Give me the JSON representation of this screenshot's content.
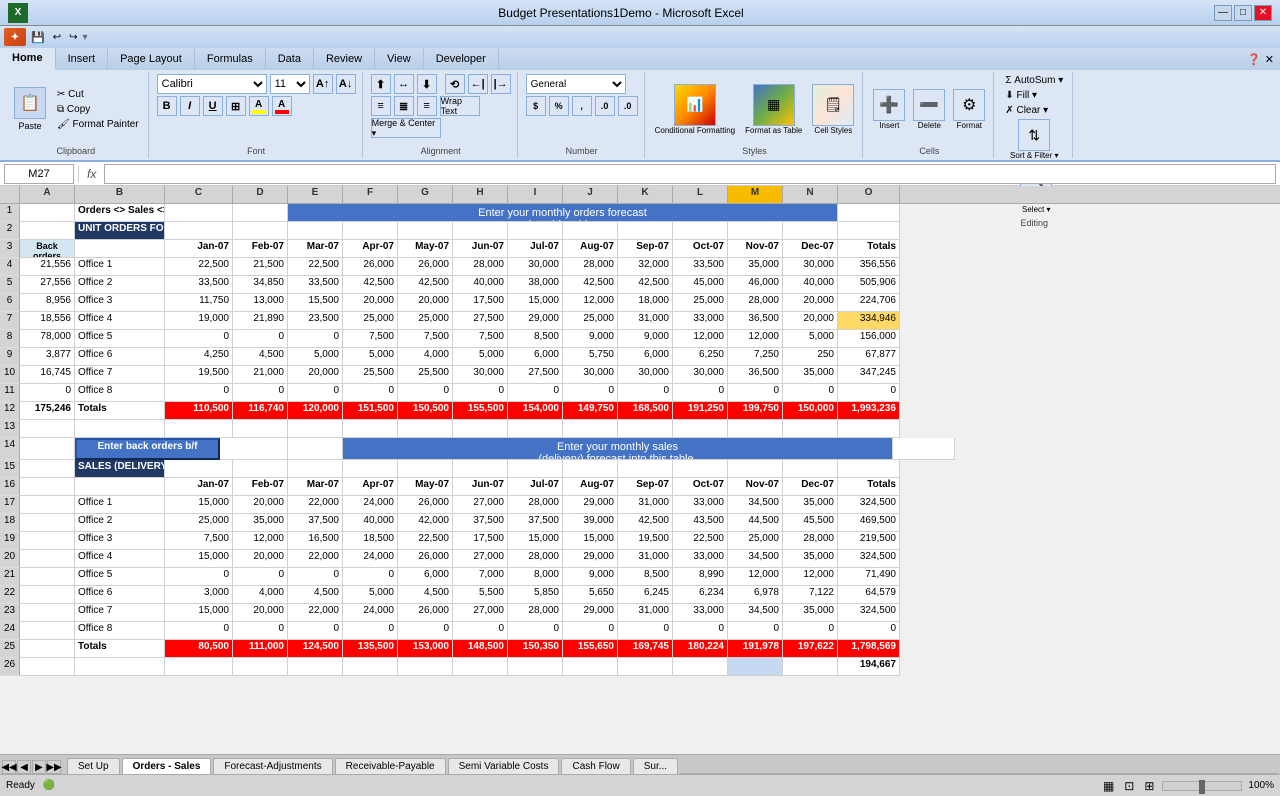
{
  "titleBar": {
    "title": "Budget Presentations1Demo - Microsoft Excel",
    "minimize": "—",
    "maximize": "□",
    "close": "✕"
  },
  "ribbonTabs": [
    {
      "label": "Home",
      "active": true
    },
    {
      "label": "Insert",
      "active": false
    },
    {
      "label": "Page Layout",
      "active": false
    },
    {
      "label": "Formulas",
      "active": false
    },
    {
      "label": "Data",
      "active": false
    },
    {
      "label": "Review",
      "active": false
    },
    {
      "label": "View",
      "active": false
    },
    {
      "label": "Developer",
      "active": false
    }
  ],
  "ribbon": {
    "clipboard": {
      "paste": "Paste",
      "cut": "Cut",
      "copy": "Copy",
      "formatPainter": "Format Painter",
      "label": "Clipboard"
    },
    "font": {
      "name": "Calibri",
      "size": "11",
      "bold": "B",
      "italic": "I",
      "underline": "U",
      "label": "Font"
    },
    "alignment": {
      "label": "Alignment",
      "wrapText": "Wrap Text",
      "mergeCenter": "Merge & Center"
    },
    "number": {
      "format": "General",
      "label": "Number"
    },
    "styles": {
      "conditional": "Conditional\nFormatting",
      "formatTable": "Format\nas Table",
      "cellStyles": "Cell\nStyles",
      "label": "Styles"
    },
    "cells": {
      "insert": "Insert",
      "delete": "Delete",
      "format": "Format",
      "label": "Cells"
    },
    "editing": {
      "autoSum": "AutoSum",
      "fill": "Fill",
      "clear": "Clear",
      "sortFilter": "Sort &\nFilter",
      "findSelect": "Find &\nSelect",
      "label": "Editing"
    }
  },
  "formulaBar": {
    "cellRef": "M27",
    "fx": "fx",
    "formula": ""
  },
  "columns": [
    "A",
    "B",
    "C",
    "D",
    "E",
    "F",
    "G",
    "H",
    "I",
    "J",
    "K",
    "L",
    "M",
    "N",
    "O"
  ],
  "rows": [
    {
      "num": 1,
      "cells": [
        {
          "col": "A",
          "val": "",
          "style": ""
        },
        {
          "col": "B",
          "val": "Orders <> Sales <> Back Orders (Units)",
          "style": "bold",
          "colspan": 4
        },
        {
          "col": "C",
          "val": "",
          "style": ""
        },
        {
          "col": "D",
          "val": "",
          "style": ""
        },
        {
          "col": "E",
          "val": "",
          "style": "blue-header merged",
          "colspan": 9
        },
        {
          "col": "F",
          "val": "",
          "style": ""
        },
        {
          "col": "G",
          "val": "",
          "style": ""
        },
        {
          "col": "H",
          "val": "",
          "style": ""
        },
        {
          "col": "I",
          "val": "",
          "style": ""
        },
        {
          "col": "J",
          "val": "",
          "style": ""
        },
        {
          "col": "K",
          "val": "",
          "style": ""
        },
        {
          "col": "L",
          "val": "",
          "style": ""
        },
        {
          "col": "M",
          "val": "",
          "style": ""
        },
        {
          "col": "N",
          "val": "",
          "style": ""
        },
        {
          "col": "O",
          "val": "",
          "style": ""
        }
      ]
    }
  ],
  "headerRow1": "Orders <> Sales <> Back Orders (Units)",
  "headerBlue1": "Enter your monthly  orders forecast\ninto this table.",
  "unitOrdersLabel": "UNIT ORDERS FORECAST",
  "ordersMonths": [
    "Jan-07",
    "Feb-07",
    "Mar-07",
    "Apr-07",
    "May-07",
    "Jun-07",
    "Jul-07",
    "Aug-07",
    "Sep-07",
    "Oct-07",
    "Nov-07",
    "Dec-07",
    "Totals"
  ],
  "backOrdersLabel": "Back\norders",
  "officeLabels": [
    "Office 1",
    "Office 2",
    "Office 3",
    "Office 4",
    "Office 5",
    "Office 6",
    "Office 7",
    "Office 8",
    "Totals"
  ],
  "ordersData": {
    "headers": [
      "",
      "",
      "Jan-07",
      "Feb-07",
      "Mar-07",
      "Apr-07",
      "May-07",
      "Jun-07",
      "Jul-07",
      "Aug-07",
      "Sep-07",
      "Oct-07",
      "Nov-07",
      "Dec-07",
      "Totals"
    ],
    "backOrders": [
      21556,
      27556,
      8956,
      18556,
      78000,
      3877,
      16745,
      0,
      175246
    ],
    "offices": [
      [
        22500,
        21500,
        22500,
        26000,
        26000,
        28000,
        30000,
        28000,
        32000,
        33500,
        35000,
        30000,
        356556
      ],
      [
        33500,
        34850,
        33500,
        42500,
        42500,
        40000,
        38000,
        42500,
        42500,
        45000,
        46000,
        40000,
        505906
      ],
      [
        11750,
        13000,
        15500,
        20000,
        20000,
        17500,
        15000,
        12000,
        18000,
        25000,
        28000,
        20000,
        224706
      ],
      [
        19000,
        21890,
        23500,
        25000,
        25000,
        27500,
        29000,
        25000,
        31000,
        33000,
        36500,
        20000,
        334946
      ],
      [
        0,
        0,
        0,
        7500,
        7500,
        7500,
        8500,
        9000,
        9000,
        12000,
        12000,
        5000,
        156000
      ],
      [
        4250,
        4500,
        5000,
        5000,
        4000,
        5000,
        6000,
        5750,
        6000,
        6250,
        7250,
        250,
        67877
      ],
      [
        19500,
        21000,
        20000,
        25500,
        25500,
        30000,
        27500,
        30000,
        30000,
        30000,
        36500,
        35000,
        347245
      ],
      [
        0,
        0,
        0,
        0,
        0,
        0,
        0,
        0,
        0,
        0,
        0,
        0,
        0
      ],
      [
        110500,
        116740,
        120000,
        151500,
        150500,
        155500,
        154000,
        149750,
        168500,
        191250,
        199750,
        150000,
        1993236
      ]
    ]
  },
  "salesData": {
    "headerBlue": "Enter your monthly sales\n(delivery) forecast into this table.",
    "label": "SALES (DELIVERY) FORECAST",
    "backOrders": [],
    "offices": [
      [
        15000,
        20000,
        22000,
        24000,
        26000,
        27000,
        28000,
        29000,
        31000,
        33000,
        34500,
        35000,
        324500
      ],
      [
        25000,
        35000,
        37500,
        40000,
        42000,
        37500,
        37500,
        39000,
        42500,
        43500,
        44500,
        45500,
        469500
      ],
      [
        7500,
        12000,
        16500,
        18500,
        22500,
        17500,
        15000,
        15000,
        19500,
        22500,
        25000,
        28000,
        219500
      ],
      [
        15000,
        20000,
        22000,
        24000,
        26000,
        27000,
        28000,
        29000,
        31000,
        33000,
        34500,
        35000,
        324500
      ],
      [
        0,
        0,
        0,
        0,
        6000,
        7000,
        8000,
        9000,
        8500,
        8990,
        12000,
        12000,
        71490
      ],
      [
        3000,
        4000,
        4500,
        5000,
        4500,
        5500,
        5850,
        5650,
        6245,
        6234,
        6978,
        7122,
        64579
      ],
      [
        15000,
        20000,
        22000,
        24000,
        26000,
        27000,
        28000,
        29000,
        31000,
        33000,
        34500,
        35000,
        324500
      ],
      [
        0,
        0,
        0,
        0,
        0,
        0,
        0,
        0,
        0,
        0,
        0,
        0,
        0
      ],
      [
        80500,
        111000,
        124500,
        135500,
        153000,
        148500,
        150350,
        155650,
        169745,
        180224,
        191978,
        197622,
        1798569
      ]
    ]
  },
  "sheetTabs": [
    "Set Up",
    "Orders - Sales",
    "Forecast-Adjustments",
    "Receivable-Payable",
    "Semi Variable Costs",
    "Cash Flow",
    "Sur..."
  ],
  "activeTab": "Orders - Sales",
  "statusBar": {
    "ready": "Ready",
    "zoom": "100%"
  }
}
